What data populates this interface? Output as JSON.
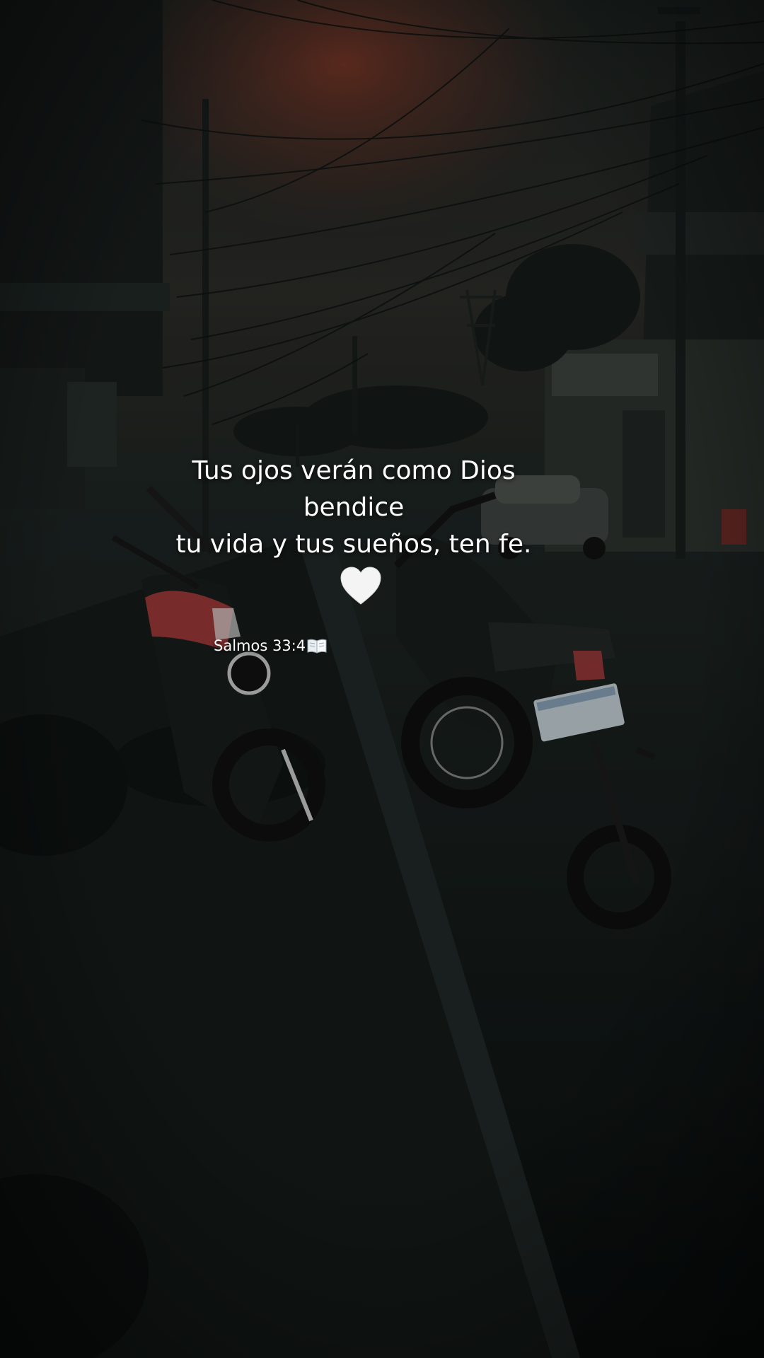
{
  "quote": {
    "line1": "Tus ojos verán como Dios",
    "line2": "bendice",
    "line3": "tu vida y tus sueños, ten fe.",
    "heart_icon": "white-heart-icon",
    "heart_color": "#f4f4f4"
  },
  "reference": {
    "text": "Salmos 33:4",
    "icon": "open-book-icon"
  },
  "colors": {
    "sky_glow": "#7a3424",
    "night_ground": "#0f1513",
    "moto_red": "#a83a3a"
  }
}
